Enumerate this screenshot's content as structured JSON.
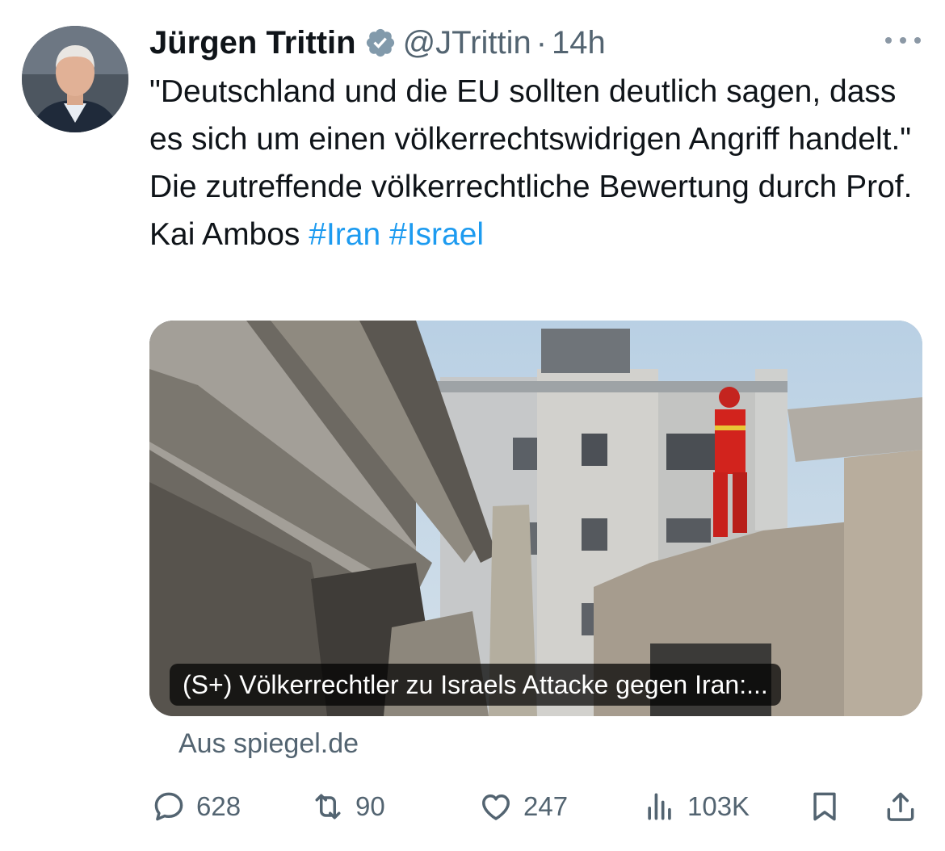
{
  "tweet": {
    "author_name": "Jürgen Trittin",
    "handle": "@JTrittin",
    "separator": "·",
    "time": "14h",
    "text_prefix": "\"Deutschland und die EU sollten deutlich sagen, dass es sich um einen völkerrechtswidrigen Angriff handelt.\" Die zutreffende völkerrechtliche Bewertung durch Prof. Kai Ambos",
    "hashtags": [
      "#Iran",
      "#Israel"
    ]
  },
  "card": {
    "title": "(S+) Völkerrechtler zu Israels Attacke gegen Iran:...",
    "source": "Aus spiegel.de"
  },
  "actions": {
    "replies": "628",
    "reposts": "90",
    "likes": "247",
    "views": "103K"
  },
  "icons": {
    "verified": "verified-badge-icon",
    "more": "more-icon",
    "reply": "reply-icon",
    "repost": "repost-icon",
    "like": "heart-icon",
    "views": "views-icon",
    "bookmark": "bookmark-icon",
    "share": "share-icon"
  },
  "colors": {
    "text": "#0f1419",
    "secondary": "#536471",
    "link": "#1d9bf0",
    "verified_badge": "#829aab"
  }
}
